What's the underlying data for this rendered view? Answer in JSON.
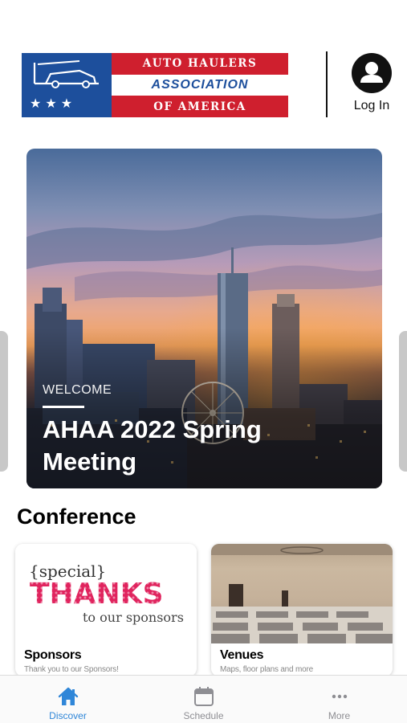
{
  "header": {
    "logo": {
      "line1": "AUTO HAULERS",
      "line2": "ASSOCIATION",
      "line3": "OF AMERICA",
      "stars": "★★★"
    },
    "login_label": "Log In"
  },
  "hero": {
    "kicker": "WELCOME",
    "title": "AHAA 2022 Spring Meeting"
  },
  "section": {
    "title": "Conference"
  },
  "cards": [
    {
      "label": "Sponsors",
      "subtitle": "Thank you to our Sponsors!",
      "art": {
        "special": "{special}",
        "big": "THANKS",
        "sub": "to our sponsors"
      }
    },
    {
      "label": "Venues",
      "subtitle": "Maps, floor plans and more"
    }
  ],
  "tabbar": {
    "tabs": [
      {
        "label": "Discover",
        "icon": "home-icon",
        "active": true
      },
      {
        "label": "Schedule",
        "icon": "calendar-icon",
        "active": false
      },
      {
        "label": "More",
        "icon": "more-icon",
        "active": false
      }
    ]
  },
  "colors": {
    "accent": "#2f86d8",
    "logo_blue": "#1d4f9c",
    "logo_red": "#cf1f2e",
    "thanks_pink": "#e0245e"
  }
}
